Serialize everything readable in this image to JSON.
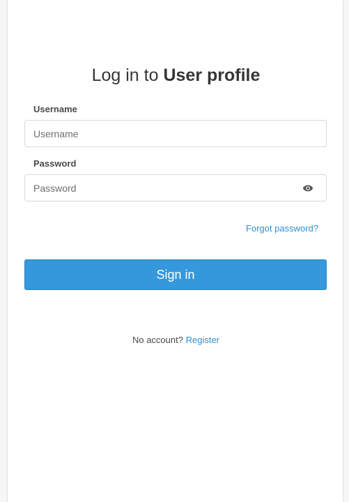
{
  "heading": {
    "prefix": "Log in to ",
    "app_name": "User profile"
  },
  "form": {
    "username": {
      "label": "Username",
      "placeholder": "Username",
      "value": ""
    },
    "password": {
      "label": "Password",
      "placeholder": "Password",
      "value": "",
      "toggle_icon": "eye-icon"
    },
    "forgot_password": "Forgot password?",
    "submit_label": "Sign in"
  },
  "footer": {
    "no_account_text": "No account?",
    "register_link": "Register"
  },
  "colors": {
    "primary": "#3598dc",
    "link": "#2f8fd4",
    "text": "#333333",
    "border": "#d8d8d8"
  }
}
